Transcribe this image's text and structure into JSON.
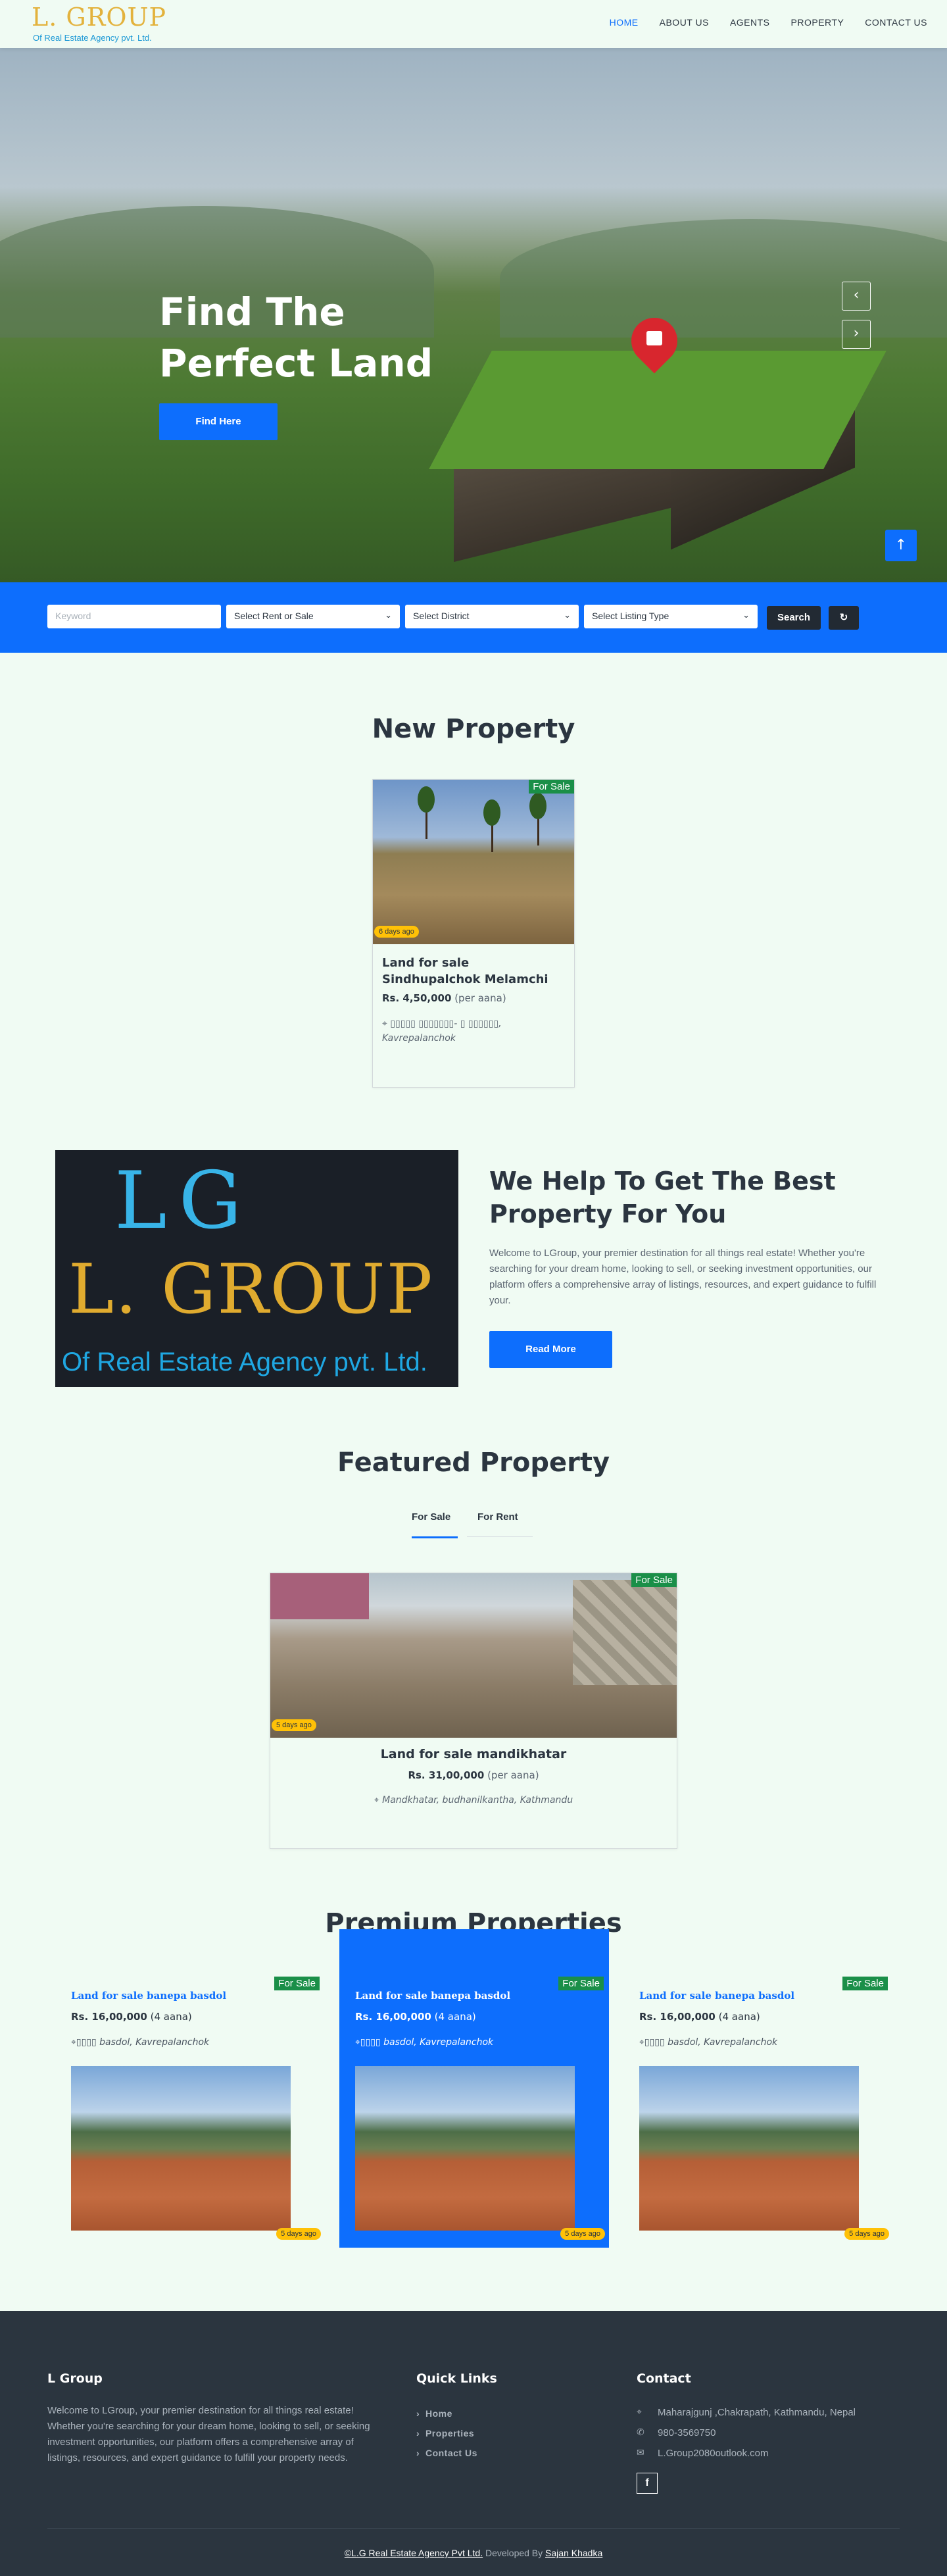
{
  "brand": {
    "logo_text": "L. GROUP",
    "tagline": "Of Real Estate Agency pvt. Ltd."
  },
  "nav": {
    "items": [
      "HOME",
      "ABOUT US",
      "AGENTS",
      "PROPERTY",
      "CONTACT US"
    ],
    "active": "HOME"
  },
  "hero": {
    "title_line1": "Find The",
    "title_line2": "Perfect Land",
    "button": "Find Here",
    "prev_icon": "‹",
    "next_icon": "›"
  },
  "scroll_top_icon": "↑",
  "search": {
    "keyword_placeholder": "Keyword",
    "rent_or_sale": "Select Rent or Sale",
    "district": "Select District",
    "listing_type": "Select Listing Type",
    "search_label": "Search",
    "reset_icon": "↻"
  },
  "new_property": {
    "heading": "New Property",
    "card": {
      "badge": "For Sale",
      "age": "6 days ago",
      "title": "Land for sale Sindhupalchok Melamchi",
      "price": "Rs. 4,50,000",
      "unit": "(per aana)",
      "location": "▯▯▯▯▯ ▯▯▯▯▯▯▯- ▯ ▯▯▯▯▯▯, Kavrepalanchok"
    }
  },
  "about": {
    "image_text_top": "LG",
    "image_text_main": "L. GROUP",
    "image_text_sub": "Of Real Estate Agency pvt. Ltd.",
    "title": "We Help To Get The Best Property For You",
    "text": "Welcome to LGroup, your premier destination for all things real estate! Whether you're searching for your dream home, looking to sell, or seeking investment opportunities, our platform offers a comprehensive array of listings, resources, and expert guidance to fulfill your.",
    "button": "Read More"
  },
  "featured": {
    "heading": "Featured Property",
    "tabs": [
      "For Sale",
      "For Rent"
    ],
    "active_tab": "For Sale",
    "card": {
      "badge": "For Sale",
      "age": "5 days ago",
      "title": "Land for sale mandikhatar",
      "price": "Rs. 31,00,000",
      "unit": "(per aana)",
      "location": "Mandkhatar, budhanilkantha, Kathmandu"
    }
  },
  "premium": {
    "heading": "Premium Properties",
    "cards": [
      {
        "badge": "For Sale",
        "title": "Land for sale banepa basdol",
        "price": "Rs. 16,00,000",
        "unit": "(4 aana)",
        "location_prefix": "▯▯▯▯",
        "location": " basdol, Kavrepalanchok",
        "age": "5 days ago"
      },
      {
        "badge": "For Sale",
        "title": "Land for sale banepa basdol",
        "price": "Rs. 16,00,000",
        "unit": "(4 aana)",
        "location_prefix": "▯▯▯▯",
        "location": " basdol, Kavrepalanchok",
        "age": "5 days ago"
      },
      {
        "badge": "For Sale",
        "title": "Land for sale banepa basdol",
        "price": "Rs. 16,00,000",
        "unit": "(4 aana)",
        "location_prefix": "▯▯▯▯",
        "location": " basdol, Kavrepalanchok",
        "age": "5 days ago"
      }
    ]
  },
  "footer": {
    "about_heading": "L Group",
    "about_text": "Welcome to LGroup, your premier destination for all things real estate! Whether you're searching for your dream home, looking to sell, or seeking investment opportunities, our platform offers a comprehensive array of listings, resources, and expert guidance to fulfill your property needs.",
    "links_heading": "Quick Links",
    "links": [
      "Home",
      "Properties",
      "Contact Us"
    ],
    "contact_heading": "Contact",
    "address": "Maharajgunj ,Chakrapath, Kathmandu, Nepal",
    "phone": "980-3569750",
    "email": "L.Group2080outlook.com",
    "facebook_icon": "f",
    "copyright": "©L.G Real Estate Agency Pvt Ltd.",
    "developed_by": " Developed By ",
    "developer": "Sajan Khadka"
  },
  "colors": {
    "primary": "#0d6efd",
    "badge_green": "#1a8f48",
    "badge_yellow": "#ffc107",
    "footer_bg": "#2b353f",
    "page_bg": "#f0fbf3"
  }
}
